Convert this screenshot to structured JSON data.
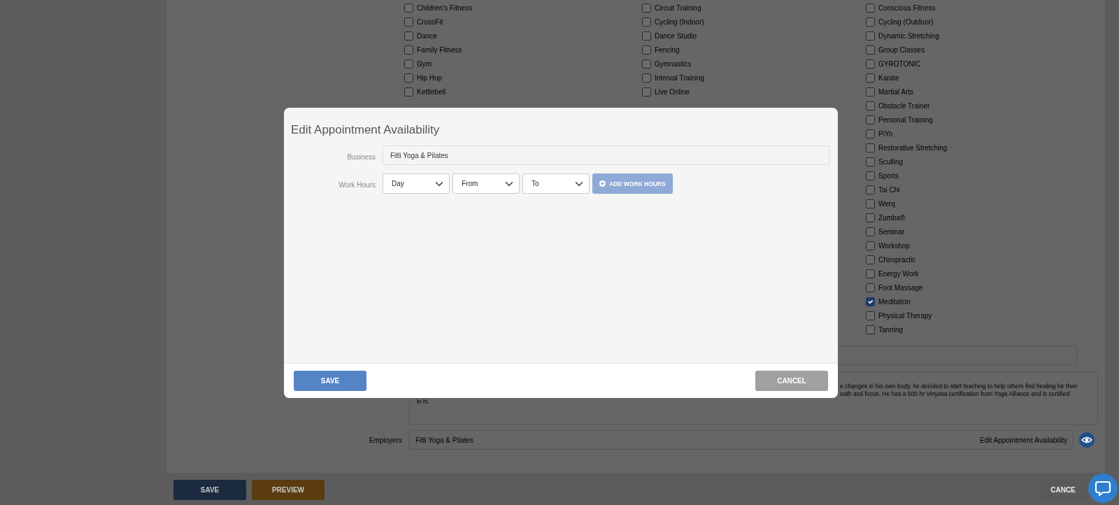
{
  "background": {
    "services": [
      [
        {
          "label": "Children's Fitness",
          "checked": false
        },
        {
          "label": "CrossFit",
          "checked": false
        },
        {
          "label": "Dance",
          "checked": false
        },
        {
          "label": "Family Fitness",
          "checked": false
        },
        {
          "label": "Gym",
          "checked": false
        },
        {
          "label": "Hip Hop",
          "checked": false
        },
        {
          "label": "Kettlebell",
          "checked": false
        }
      ],
      [
        {
          "label": "Circuit Training",
          "checked": false
        },
        {
          "label": "Cycling (Indoor)",
          "checked": false
        },
        {
          "label": "Dance Studio",
          "checked": false
        },
        {
          "label": "Fencing",
          "checked": false
        },
        {
          "label": "Gymnastics",
          "checked": false
        },
        {
          "label": "Interval Training",
          "checked": false
        },
        {
          "label": "Live Online",
          "checked": false
        }
      ],
      [
        {
          "label": "Conscious Fitness",
          "checked": false
        },
        {
          "label": "Cycling (Outdoor)",
          "checked": false
        },
        {
          "label": "Dynamic Stretching",
          "checked": false
        },
        {
          "label": "Group Classes",
          "checked": false
        },
        {
          "label": "GYROTONIC",
          "checked": false
        },
        {
          "label": "Karate",
          "checked": false
        },
        {
          "label": "Martial Arts",
          "checked": false
        },
        {
          "label": "Obstacle Trainer",
          "checked": false
        },
        {
          "label": "Personal Training",
          "checked": false
        },
        {
          "label": "PiYo",
          "checked": false
        },
        {
          "label": "Restorative Stretching",
          "checked": false
        },
        {
          "label": "Sculling",
          "checked": false
        },
        {
          "label": "Sports",
          "checked": false
        },
        {
          "label": "Tai Chi",
          "checked": false
        },
        {
          "label": "Werq",
          "checked": false
        },
        {
          "label": "Zumba®",
          "checked": false
        },
        {
          "label": "Seminar",
          "checked": false
        },
        {
          "label": "Workshop",
          "checked": false
        },
        {
          "label": "Chiropractic",
          "checked": false
        },
        {
          "label": "Energy Work",
          "checked": false
        },
        {
          "label": "Foot Massage",
          "checked": false
        },
        {
          "label": "Meditation",
          "checked": true
        },
        {
          "label": "Physical Therapy",
          "checked": false
        },
        {
          "label": "Tanning",
          "checked": false
        }
      ]
    ],
    "bio_lines": [
      "e changes in his own body, he decided to start teaching to help others find healing for their",
      "eath and focus. He has a 500 hr Vinyasa certification from Yoga Alliance and is certified",
      "in hi."
    ],
    "employers": {
      "label": "Employers",
      "value": "Fitli Yoga & Pilates",
      "link": "Edit Appointment Availability"
    },
    "buttons": [
      {
        "label": "SAVE",
        "kind": "save"
      },
      {
        "label": "PREVIEW",
        "kind": "preview"
      },
      {
        "label": "CANCE",
        "kind": "cancel"
      }
    ]
  },
  "modal": {
    "title": "Edit Appointment Availability",
    "business": {
      "label": "Business",
      "value": "Fitli Yoga & Pilates"
    },
    "work_hours": {
      "label": "Work Hours",
      "selects": [
        "Day",
        "From",
        "To"
      ],
      "add_button": "ADD WORK HOURS"
    },
    "buttons": [
      {
        "label": "SAVE",
        "kind": "save"
      },
      {
        "label": "CANCEL",
        "kind": "cancel"
      }
    ]
  }
}
